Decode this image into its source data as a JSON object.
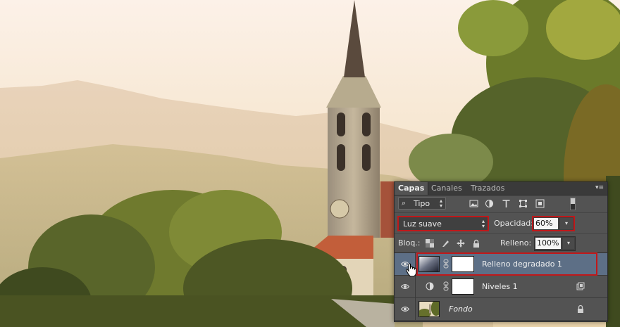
{
  "panel": {
    "tabs": [
      {
        "label": "Capas",
        "active": true
      },
      {
        "label": "Canales",
        "active": false
      },
      {
        "label": "Trazados",
        "active": false
      }
    ],
    "filter": {
      "label": "Tipo"
    },
    "blend_mode": "Luz suave",
    "opacity_label": "Opacidad:",
    "opacity_value": "60%",
    "lock_label": "Bloq.:",
    "fill_label": "Relleno:",
    "fill_value": "100%",
    "layers": [
      {
        "name": "Relleno degradado 1",
        "visible": true,
        "selected": true,
        "type": "gradient-fill"
      },
      {
        "name": "Niveles 1",
        "visible": true,
        "selected": false,
        "type": "levels-adjustment"
      },
      {
        "name": "Fondo",
        "visible": true,
        "selected": false,
        "type": "background",
        "locked": true
      }
    ]
  },
  "colors": {
    "panel_bg": "#535353",
    "selected_layer": "#5d6f86",
    "highlight_red": "#c0181a"
  }
}
